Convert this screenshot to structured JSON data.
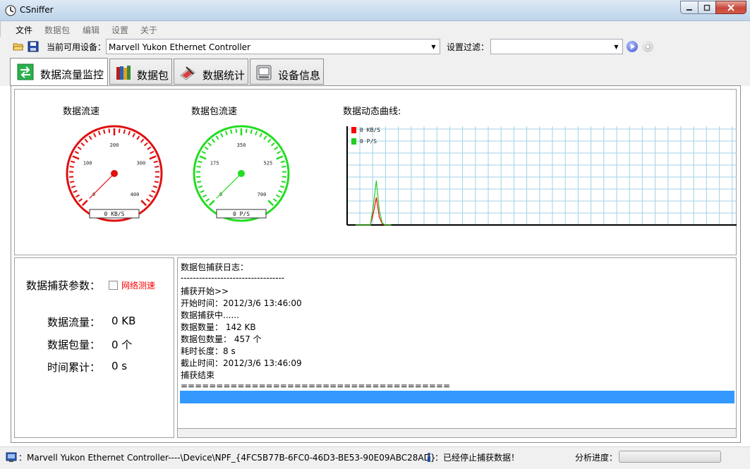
{
  "window": {
    "title": "CSniffer"
  },
  "menu": {
    "items": [
      "文件",
      "数据包",
      "编辑",
      "设置",
      "关于"
    ]
  },
  "toolbar": {
    "device_label": "当前可用设备：",
    "device_value": "Marvell Yukon Ethernet Controller",
    "filter_label": "设置过滤：",
    "filter_value": "",
    "icons": [
      "open-folder-icon",
      "save-icon",
      "start-icon",
      "stop-icon"
    ]
  },
  "tabs": [
    {
      "label": "数据流量监控",
      "icon": "green-arrows-icon",
      "active": true
    },
    {
      "label": "数据包",
      "icon": "books-icon",
      "active": false
    },
    {
      "label": "数据统计",
      "icon": "pen-tablet-icon",
      "active": false
    },
    {
      "label": "设备信息",
      "icon": "device-icon",
      "active": false
    }
  ],
  "gauges": [
    {
      "title": "数据流速",
      "ticks": [
        "0",
        "100",
        "200",
        "300",
        "400"
      ],
      "readout": "0 KB/S",
      "color": "#e01010"
    },
    {
      "title": "数据包流速",
      "ticks": [
        "0",
        "175",
        "350",
        "525",
        "700"
      ],
      "readout": "0 P/S",
      "color": "#22dd22"
    }
  ],
  "chart": {
    "title": "数据动态曲线:",
    "legend": [
      {
        "label": "0 KB/S",
        "color": "#ff0000"
      },
      {
        "label": "0 P/S",
        "color": "#22cc22"
      }
    ],
    "grid_color": "#9fd3e6"
  },
  "chart_data": {
    "type": "line",
    "xlabel": "",
    "ylabel": "",
    "series": [
      {
        "name": "0 KB/S",
        "color": "#ff0000",
        "values": [
          0,
          0,
          0,
          0,
          0,
          0,
          0.12,
          0.28,
          0.08,
          0.01,
          0,
          0,
          0
        ]
      },
      {
        "name": "0 P/S",
        "color": "#22cc22",
        "values": [
          0,
          0,
          0,
          0,
          0,
          0,
          0.2,
          0.45,
          0.15,
          0.02,
          0,
          0,
          0
        ]
      }
    ]
  },
  "params": {
    "heading": "数据捕获参数：",
    "checkbox_label": "网络测速",
    "checkbox_color": "#ff0000",
    "rows": [
      {
        "label": "数据流量：",
        "value": "0 KB"
      },
      {
        "label": "数据包量：",
        "value": "0 个"
      },
      {
        "label": "时间累计：",
        "value": "0 s"
      }
    ]
  },
  "log": {
    "lines": [
      "数据包捕获日志：",
      "----------------------------------",
      "捕获开始>>",
      "开始时间：2012/3/6 13:46:00",
      "数据捕获中......",
      "数据数量： 142 KB",
      "数据包数量： 457 个",
      "耗时长度：8 s",
      "截止时间：2012/3/6 13:46:09",
      "捕获结束",
      "======================================"
    ]
  },
  "status": {
    "device_path": "：Marvell Yukon Ethernet Controller----\\Device\\NPF_{4FC5B77B-6FC0-46D3-BE53-90E09ABC28AD}",
    "state": "：已经停止捕获数据！",
    "progress_label": "分析进度："
  }
}
